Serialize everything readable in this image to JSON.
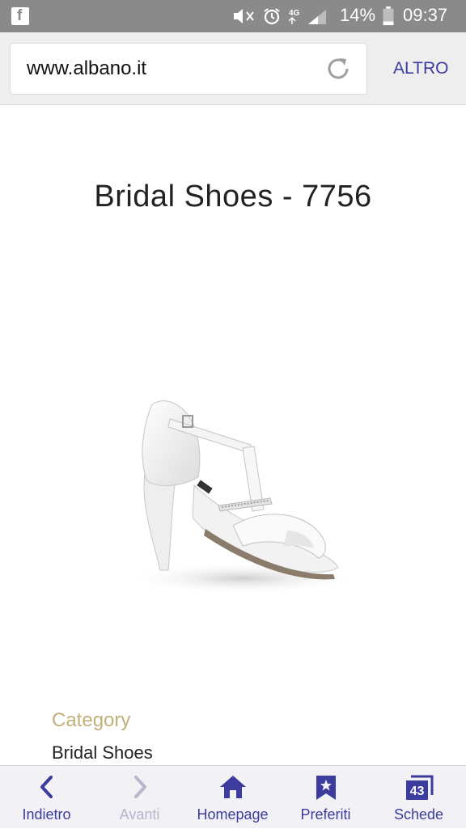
{
  "status_bar": {
    "battery": "14%",
    "time": "09:37",
    "network": "4G",
    "icons": [
      "facebook-icon",
      "mute-icon",
      "alarm-icon",
      "4g-icon",
      "signal-icon",
      "battery-icon"
    ]
  },
  "browser": {
    "url": "www.albano.it",
    "menu_label": "ALTRO"
  },
  "page": {
    "title": "Bridal Shoes - 7756",
    "category_label": "Category",
    "category_value": "Bridal Shoes"
  },
  "bottom_nav": [
    {
      "label": "Indietro",
      "icon": "back-icon",
      "enabled": true
    },
    {
      "label": "Avanti",
      "icon": "forward-icon",
      "enabled": false
    },
    {
      "label": "Homepage",
      "icon": "home-icon",
      "enabled": true
    },
    {
      "label": "Preferiti",
      "icon": "bookmark-icon",
      "enabled": true
    },
    {
      "label": "Schede",
      "icon": "tabs-icon",
      "enabled": true,
      "count": "43"
    }
  ],
  "colors": {
    "accent": "#3c3c9e",
    "category_label": "#c2b07a",
    "status_bar": "#8a8a8a"
  }
}
